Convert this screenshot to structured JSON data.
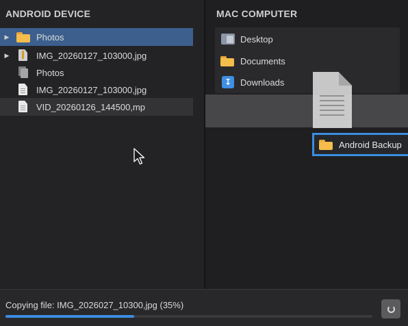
{
  "left_pane": {
    "title": "ANDROID DEVICE",
    "items": [
      {
        "label": "Photos",
        "icon": "folder-icon",
        "expandable": true
      },
      {
        "label": "IMG_20260127_103000,jpg",
        "icon": "image-file-icon",
        "expandable": true
      },
      {
        "label": "Photos",
        "icon": "photos-stack-icon",
        "expandable": false
      },
      {
        "label": "IMG_20260127_103000,jpg",
        "icon": "document-icon",
        "expandable": false
      },
      {
        "label": "VID_20260126_144500,mp",
        "icon": "document-icon",
        "expandable": false
      }
    ]
  },
  "right_pane": {
    "title": "MAC COMPUTER",
    "places": [
      {
        "label": "Desktop",
        "icon": "desktop-icon"
      },
      {
        "label": "Documents",
        "icon": "folder-icon"
      },
      {
        "label": "Downloads",
        "icon": "downloads-icon"
      }
    ],
    "drop_target": {
      "label": "Android Backup",
      "icon": "folder-icon"
    }
  },
  "status": {
    "text": "Copying file: IMG_2026027_10300,jpg (35%)",
    "progress": 0.35
  },
  "colors": {
    "accent": "#3b8de0",
    "selection": "#3c5f8d",
    "folder": "#f5bd4b"
  }
}
